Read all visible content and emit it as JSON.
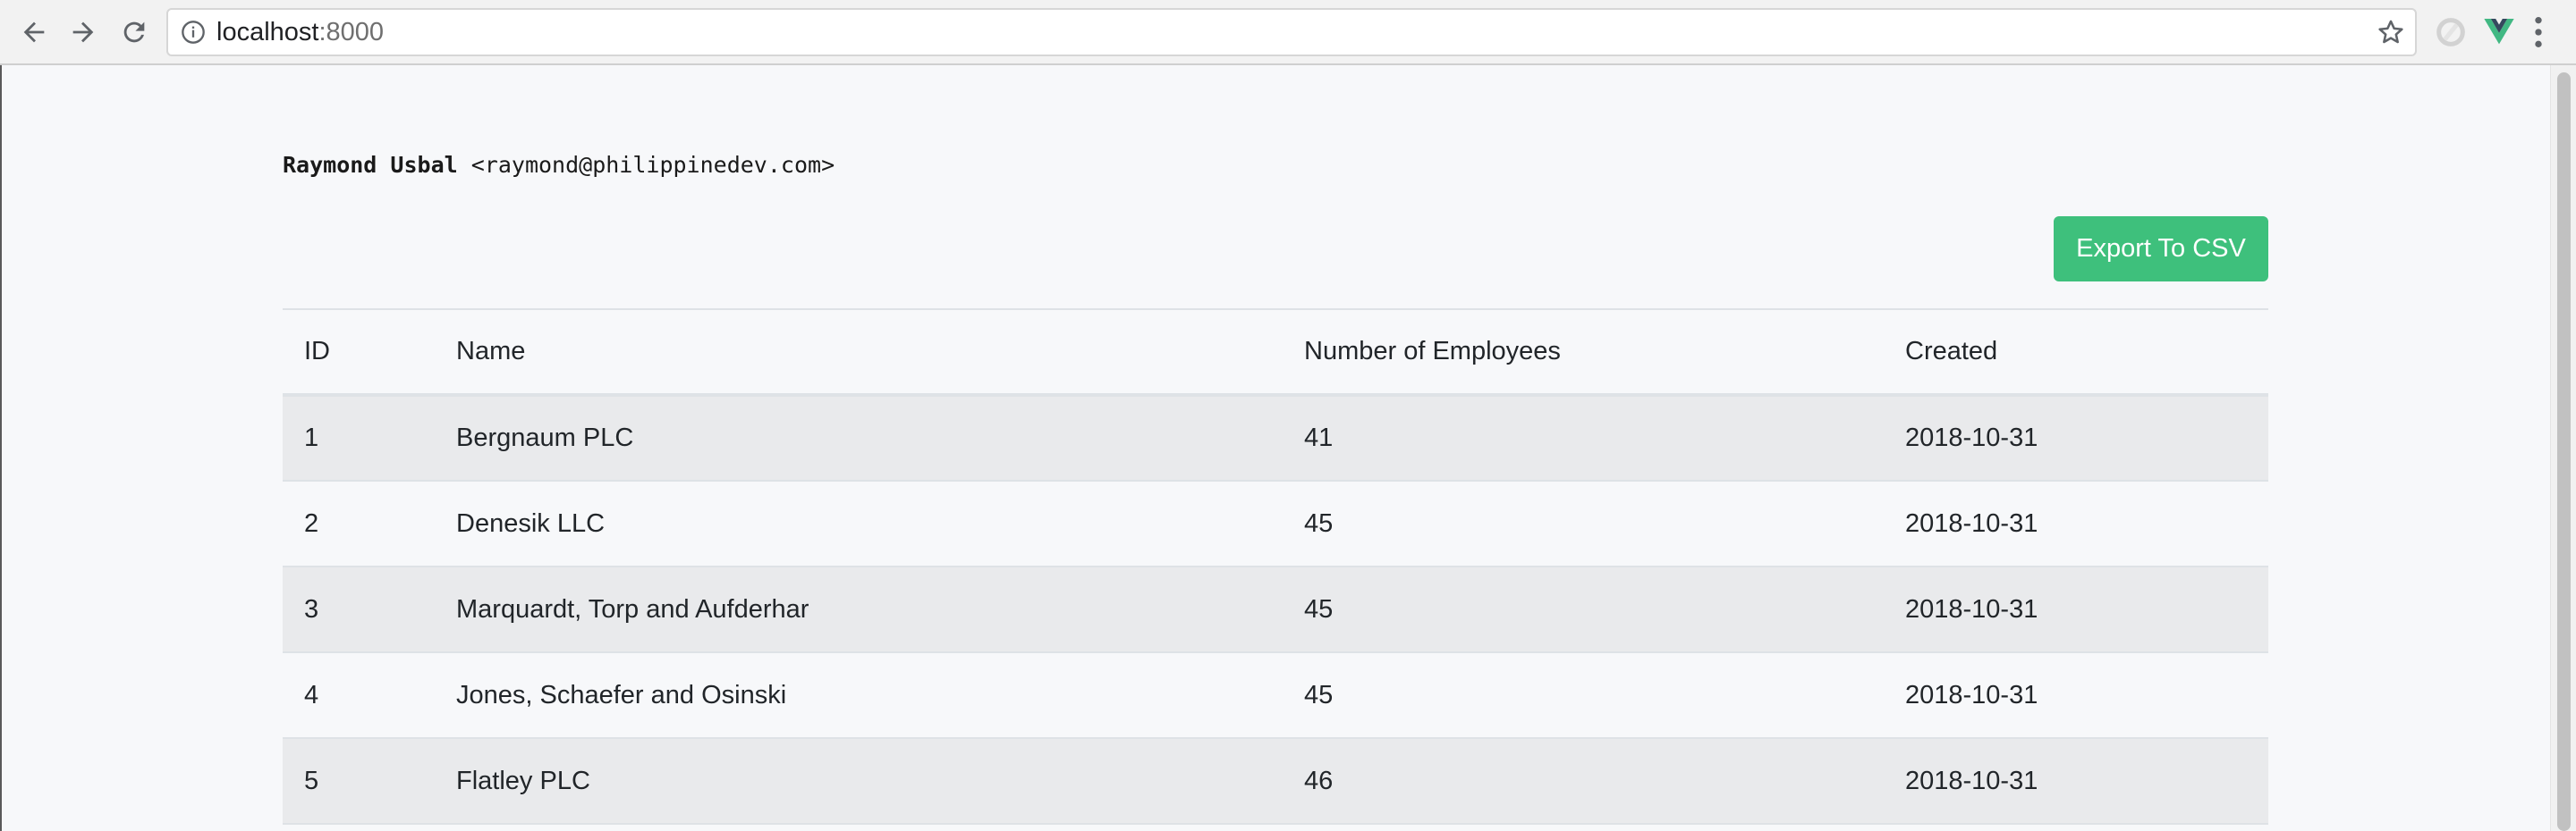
{
  "browser": {
    "url_host": "localhost",
    "url_port": ":8000"
  },
  "author": {
    "name": "Raymond Usbal",
    "email": "<raymond@philippinedev.com>"
  },
  "actions": {
    "export_label": "Export To CSV"
  },
  "table": {
    "headers": [
      "ID",
      "Name",
      "Number of Employees",
      "Created"
    ],
    "rows": [
      {
        "id": "1",
        "name": "Bergnaum PLC",
        "employees": "41",
        "created": "2018-10-31"
      },
      {
        "id": "2",
        "name": "Denesik LLC",
        "employees": "45",
        "created": "2018-10-31"
      },
      {
        "id": "3",
        "name": "Marquardt, Torp and Aufderhar",
        "employees": "45",
        "created": "2018-10-31"
      },
      {
        "id": "4",
        "name": "Jones, Schaefer and Osinski",
        "employees": "45",
        "created": "2018-10-31"
      },
      {
        "id": "5",
        "name": "Flatley PLC",
        "employees": "46",
        "created": "2018-10-31"
      }
    ]
  },
  "colors": {
    "export_button": "#3ec07c",
    "page_background": "#f7f8fa",
    "striped_row": "#e9eaec"
  },
  "icons": {
    "back": "arrow-left-icon",
    "forward": "arrow-right-icon",
    "reload": "reload-icon",
    "info": "info-icon",
    "bookmark": "star-icon",
    "extension_1": "extension-icon",
    "extension_2": "vue-devtools-icon",
    "menu": "kebab-menu-icon"
  }
}
